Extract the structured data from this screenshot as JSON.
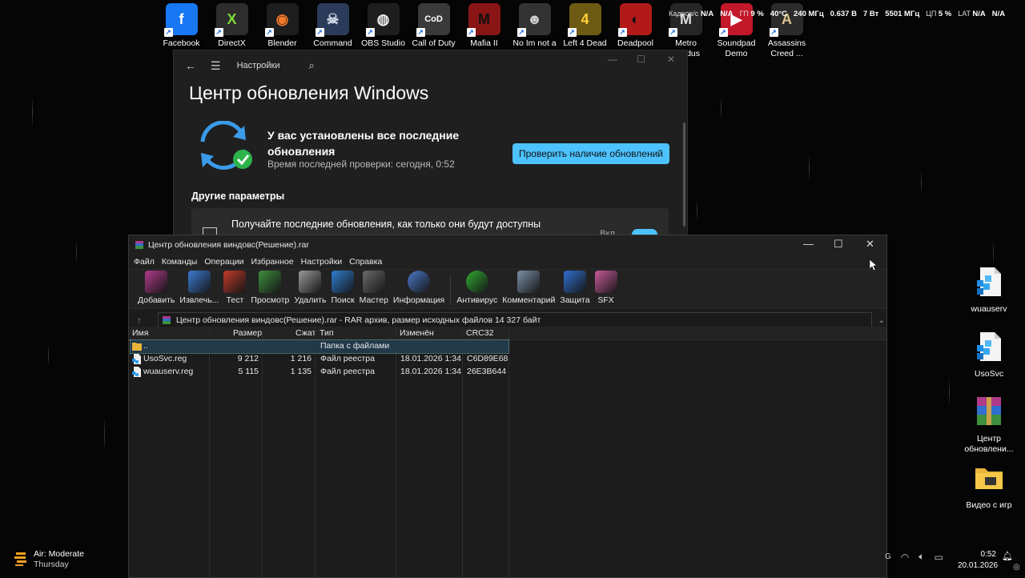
{
  "desktop_icons": [
    {
      "label": "Facebook",
      "color": "#1877f2",
      "glyph": "f",
      "glyph_color": "#fff"
    },
    {
      "label": "DirectX",
      "color": "#2d2d2d",
      "glyph": "X",
      "glyph_color": "#7fdc36"
    },
    {
      "label": "Blender",
      "color": "#1e1e1e",
      "glyph": "◉",
      "glyph_color": "#f5792a"
    },
    {
      "label": "Command",
      "color": "#2b3b5a",
      "glyph": "☠",
      "glyph_color": "#cfd8e8"
    },
    {
      "label": "OBS Studio",
      "color": "#1e1e1e",
      "glyph": "◍",
      "glyph_color": "#eeeeee"
    },
    {
      "label": "Call of Duty",
      "color": "#3a3a3a",
      "glyph": "CoD",
      "glyph_color": "#ffffff"
    },
    {
      "label": "Mafia II",
      "color": "#8a1515",
      "glyph": "M",
      "glyph_color": "#111111"
    },
    {
      "label": "No Im not a",
      "color": "#333333",
      "glyph": "☻",
      "glyph_color": "#cccccc"
    },
    {
      "label": "Left 4 Dead 2",
      "color": "#6d5a13",
      "glyph": "4",
      "glyph_color": "#ffd23a"
    },
    {
      "label": "Deadpool",
      "color": "#b21a1a",
      "glyph": "◐",
      "glyph_color": "#111111"
    },
    {
      "label": "Metro Exodus",
      "color": "#262626",
      "glyph": "M",
      "glyph_color": "#dddddd"
    },
    {
      "label": "Soundpad Demo",
      "color": "#c2182a",
      "glyph": "▶",
      "glyph_color": "#ffffff"
    },
    {
      "label": "Assassins Creed ...",
      "color": "#2b2b2b",
      "glyph": "A",
      "glyph_color": "#d9c38a"
    }
  ],
  "osd": [
    {
      "k": "Кадров/с",
      "v": "N/A"
    },
    {
      "k": "",
      "v": "N/A"
    },
    {
      "k": "ГП",
      "v": "9 %"
    },
    {
      "k": "",
      "v": "40°C"
    },
    {
      "k": "",
      "v": "240 МГц"
    },
    {
      "k": "",
      "v": "0.637 В"
    },
    {
      "k": "",
      "v": "7 Вт"
    },
    {
      "k": "",
      "v": "5501 МГц"
    },
    {
      "k": "ЦП",
      "v": "5 %"
    },
    {
      "k": "LAT",
      "v": "N/A"
    },
    {
      "k": "",
      "v": "N/A"
    }
  ],
  "right_icons": [
    {
      "label": "wuauserv",
      "type": "reg"
    },
    {
      "label": "UsoSvc",
      "type": "reg"
    },
    {
      "label": "Центр обновлени...",
      "type": "rar"
    },
    {
      "label": "Видео с игр",
      "type": "folder"
    }
  ],
  "settings": {
    "title": "Настройки",
    "heading": "Центр обновления Windows",
    "status_line": "У вас установлены все последние обновления",
    "last_check": "Время последней проверки: сегодня, 0:52",
    "check_button": "Проверить наличие обновлений",
    "other_params": "Другие параметры",
    "card_title": "Получайте последние обновления, как только они будут доступны",
    "card_toggle": "Вкл."
  },
  "rar": {
    "title": "Центр обновления виндовс(Решение).rar",
    "menu": [
      "Файл",
      "Команды",
      "Операции",
      "Избранное",
      "Настройки",
      "Справка"
    ],
    "tools": [
      {
        "label": "Добавить",
        "color": "#b03a8a"
      },
      {
        "label": "Извлечь...",
        "color": "#3a7bd5"
      },
      {
        "label": "Тест",
        "color": "#c0392b"
      },
      {
        "label": "Просмотр",
        "color": "#3f8f3f"
      },
      {
        "label": "Удалить",
        "color": "#9a9a9a"
      },
      {
        "label": "Поиск",
        "color": "#2f7fd3"
      },
      {
        "label": "Мастер",
        "color": "#6a6a6a"
      },
      {
        "label": "Информация",
        "color": "#4a78c9"
      },
      {
        "label": "Антивирус",
        "color": "#2faa2f"
      },
      {
        "label": "Комментарий",
        "color": "#7b8fa8"
      },
      {
        "label": "Защита",
        "color": "#2f6fd0"
      },
      {
        "label": "SFX",
        "color": "#c85a9a"
      }
    ],
    "address": "Центр обновления виндовс(Решение).rar - RAR архив, размер исходных файлов 14 327 байт",
    "columns": [
      "Имя",
      "Размер",
      "Сжат",
      "Тип",
      "Изменён",
      "CRC32"
    ],
    "rows": [
      {
        "name": "..",
        "size": "",
        "packed": "",
        "type": "Папка с файлами",
        "modified": "",
        "crc": ""
      },
      {
        "name": "UsoSvc.reg",
        "size": "9 212",
        "packed": "1 216",
        "type": "Файл реестра",
        "modified": "18.01.2026 1:34",
        "crc": "C6D89E68"
      },
      {
        "name": "wuauserv.reg",
        "size": "5 115",
        "packed": "1 135",
        "type": "Файл реестра",
        "modified": "18.01.2026 1:34",
        "crc": "26E3B644"
      }
    ]
  },
  "weather": {
    "line1": "Air: Moderate",
    "line2": "Thursday"
  },
  "tray": {
    "lang": "G"
  },
  "clock": {
    "time": "0:52",
    "date": "20.01.2026"
  }
}
